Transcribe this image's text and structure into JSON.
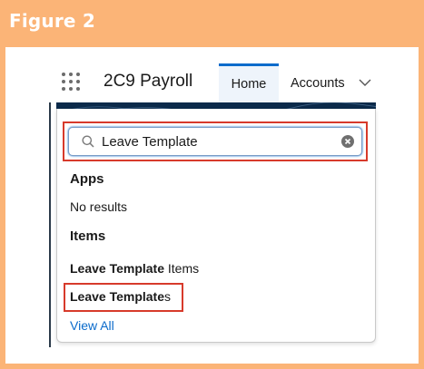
{
  "figure": {
    "label": "Figure 2"
  },
  "header": {
    "app_name": "2C9 Payroll",
    "tabs": [
      {
        "label": "Home",
        "active": true
      },
      {
        "label": "Accounts",
        "active": false
      }
    ]
  },
  "search": {
    "value": "Leave Template",
    "icon": "search-icon",
    "clear_icon": "clear-icon"
  },
  "results": {
    "apps": {
      "heading": "Apps",
      "empty_text": "No results"
    },
    "items": {
      "heading": "Items",
      "list": [
        {
          "bold": "Leave Template",
          "rest": " Items"
        },
        {
          "bold": "Leave Template",
          "rest": "s"
        }
      ]
    },
    "view_all": "View All"
  },
  "colors": {
    "frame": "#fbb477",
    "highlight_box": "#d73a2b",
    "accent": "#0b6bcb"
  }
}
